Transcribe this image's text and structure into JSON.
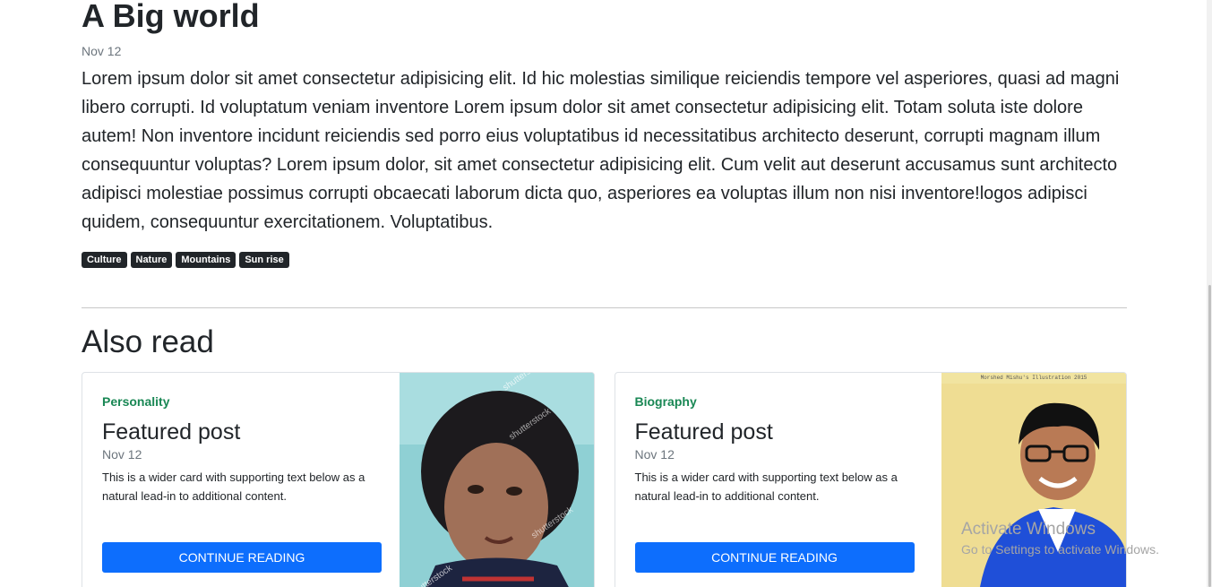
{
  "post": {
    "title": "A Big world",
    "date": "Nov 12",
    "body": "Lorem ipsum dolor sit amet consectetur adipisicing elit. Id hic molestias similique reiciendis tempore vel asperiores, quasi ad magni libero corrupti. Id voluptatum veniam inventore Lorem ipsum dolor sit amet consectetur adipisicing elit. Totam soluta iste dolore autem! Non inventore incidunt reiciendis sed porro eius voluptatibus id necessitatibus architecto deserunt, corrupti magnam illum consequuntur voluptas? Lorem ipsum dolor, sit amet consectetur adipisicing elit. Cum velit aut deserunt accusamus sunt architecto adipisci molestiae possimus corrupti obcaecati laborum dicta quo, asperiores ea voluptas illum non nisi inventore!logos adipisci quidem, consequuntur exercitationem. Voluptatibus.",
    "tags": [
      "Culture",
      "Nature",
      "Mountains",
      "Sun rise"
    ]
  },
  "also_read": {
    "heading": "Also read",
    "cards": [
      {
        "category": "Personality",
        "title": "Featured post",
        "date": "Nov 12",
        "text": "This is a wider card with supporting text below as a natural lead-in to additional content.",
        "button": "Continue reading",
        "image_watermark": "shutterstock"
      },
      {
        "category": "Biography",
        "title": "Featured post",
        "date": "Nov 12",
        "text": "This is a wider card with supporting text below as a natural lead-in to additional content.",
        "button": "Continue reading",
        "image_caption": "Morshed Mishu's Illustration 2015"
      }
    ]
  },
  "windows_watermark": {
    "title": "Activate Windows",
    "subtitle": "Go to Settings to activate Windows."
  },
  "colors": {
    "accent": "#0d6efd",
    "category": "#198754",
    "tag_bg": "#212529"
  }
}
